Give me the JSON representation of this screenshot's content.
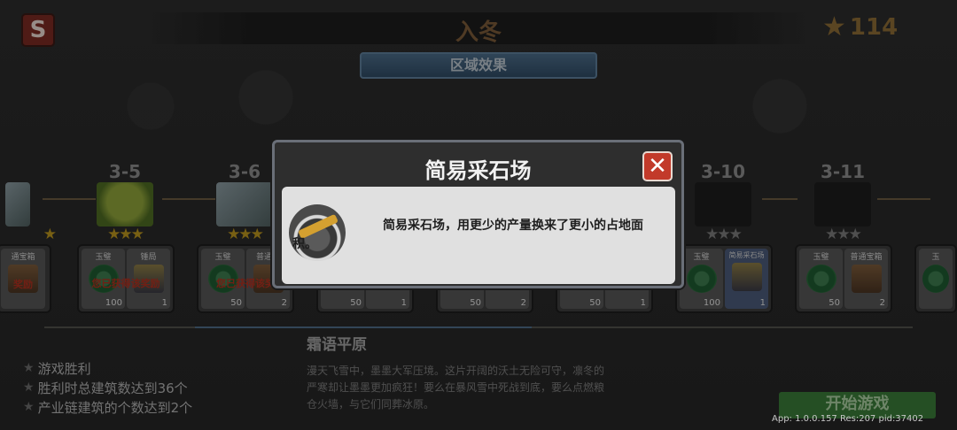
{
  "header": {
    "level_title": "入冬",
    "star_total": "114",
    "region_effect_label": "区域效果"
  },
  "levels": [
    {
      "label": "3-5",
      "stars": [
        "★",
        "★",
        "★"
      ],
      "icon": "grass-tile-icon"
    },
    {
      "label": "3-6",
      "stars": [
        "★",
        "★",
        "★"
      ],
      "icon": "snow-tile-icon"
    },
    {
      "label": "3-10",
      "stars": [
        "★",
        "★",
        "★"
      ],
      "icon": "locked-tile-icon"
    },
    {
      "label": "3-11",
      "stars": [
        "★",
        "★",
        "★"
      ],
      "icon": "locked-tile-icon"
    }
  ],
  "rewards": {
    "edge_left": {
      "name": "通宝箱",
      "claimed": "奖励"
    },
    "l35": [
      {
        "name": "玉璧",
        "count": "100"
      },
      {
        "name": "锤局",
        "count": "1"
      }
    ],
    "l35_claimed": "您已获得该奖励",
    "l36": [
      {
        "name": "玉璧",
        "count": "50"
      },
      {
        "name": "普通宝",
        "count": "2"
      }
    ],
    "l36_claimed": "您已获得该奖",
    "l37": [
      {
        "count": "50"
      },
      {
        "count": "1"
      }
    ],
    "l38": [
      {
        "count": "50"
      },
      {
        "count": "2"
      }
    ],
    "l39": [
      {
        "count": "50"
      },
      {
        "count": "1"
      }
    ],
    "l310": [
      {
        "name": "玉璧",
        "count": "100"
      },
      {
        "name": "简易采石场",
        "count": "1"
      }
    ],
    "l311": [
      {
        "name": "玉璧",
        "count": "50"
      },
      {
        "name": "普通宝箱",
        "count": "2"
      }
    ],
    "edge_right": {
      "name": "玉"
    }
  },
  "region": {
    "name": "霜语平原",
    "objectives": [
      "游戏胜利",
      "胜利时总建筑数达到36个",
      "产业链建筑的个数达到2个"
    ],
    "story": "漫天飞雪中，墨墨大军压境。这片开阔的沃土无险可守，凛冬的严寒却让墨墨更加疯狂！要么在暴风雪中死战到底，要么点燃粮仓火墙，与它们同葬冰原。"
  },
  "start_button": "开始游戏",
  "version": "App: 1.0.0.157 Res:207 pid:37402",
  "dialog": {
    "title": "简易采石场",
    "close_symbol": "✕",
    "description": "简易采石场，用更少的产量换来了更小的占地面积。"
  },
  "colors": {
    "star_gold": "#b8941e",
    "close_red": "#c23a2a",
    "start_green": "#3a7a38",
    "region_blue": "#3f5e7a"
  }
}
